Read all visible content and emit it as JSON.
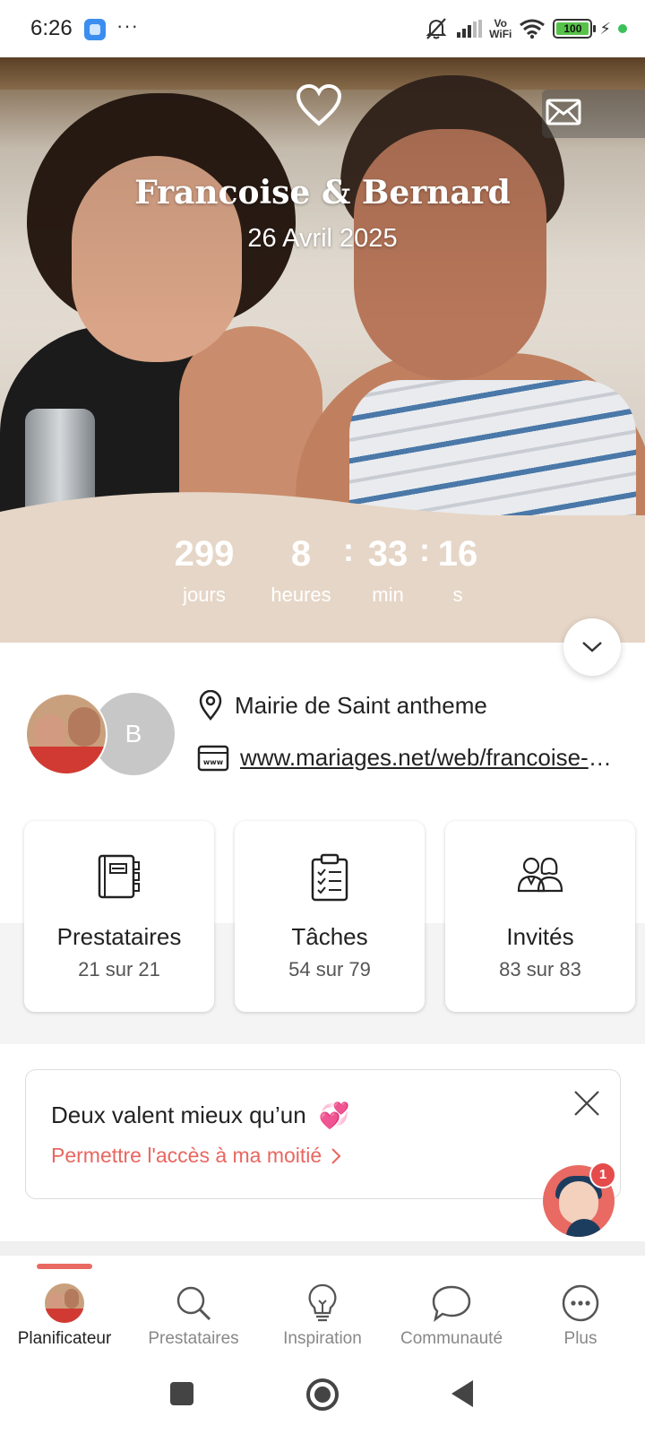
{
  "status_bar": {
    "time": "6:26",
    "dots": "···",
    "vowifi_line1": "Vo",
    "vowifi_line2": "WiFi",
    "battery": "100"
  },
  "hero": {
    "couple_name": "Francoise & Bernard",
    "wedding_date": "26 Avril 2025"
  },
  "countdown": {
    "days": "299",
    "days_label": "jours",
    "hours": "8",
    "hours_label": "heures",
    "minutes": "33",
    "minutes_label": "min",
    "seconds": "16",
    "seconds_label": "s",
    "separator": ":"
  },
  "info": {
    "avatar_initial": "B",
    "venue": "Mairie de Saint antheme",
    "website": "www.mariages.net/web/francoise-et-bernard"
  },
  "cards": [
    {
      "title": "Prestataires",
      "value": "21 sur 21",
      "icon": "notebook-icon"
    },
    {
      "title": "Tâches",
      "value": "54 sur 79",
      "icon": "checklist-icon"
    },
    {
      "title": "Invités",
      "value": "83 sur 83",
      "icon": "guests-icon"
    }
  ],
  "promo": {
    "title": "Deux valent mieux qu’un",
    "link": "Permettre l'accès à ma moitié",
    "emoji": "💞"
  },
  "chat": {
    "badge": "1"
  },
  "bottom_nav": [
    {
      "label": "Planificateur",
      "active": true
    },
    {
      "label": "Prestataires"
    },
    {
      "label": "Inspiration"
    },
    {
      "label": "Communauté"
    },
    {
      "label": "Plus"
    }
  ],
  "colors": {
    "accent": "#e86a63",
    "countdown_bg": "#e6d6c7"
  }
}
